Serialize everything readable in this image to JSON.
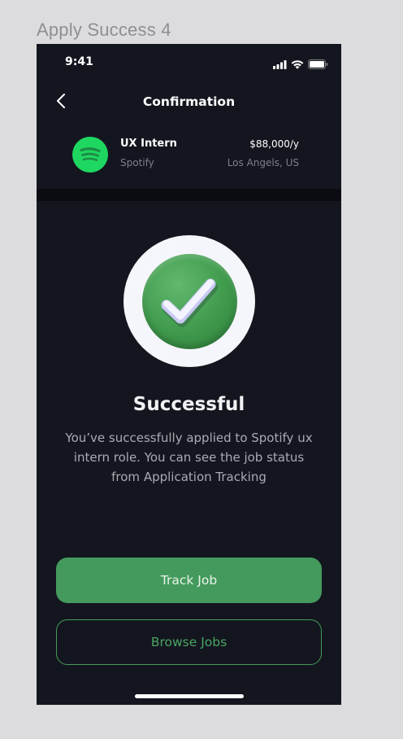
{
  "frame": {
    "title": "Apply Success 4"
  },
  "status_bar": {
    "time": "9:41",
    "icons": [
      "cellular-signal-icon",
      "wifi-icon",
      "battery-icon"
    ]
  },
  "header": {
    "back_icon": "chevron-left-icon",
    "title": "Confirmation"
  },
  "job": {
    "title": "UX Intern",
    "company": "Spotify",
    "salary": "$88,000/y",
    "location": "Los Angels, US",
    "logo_icon": "spotify-logo-icon"
  },
  "result": {
    "icon": "check-badge-icon",
    "title": "Successful",
    "message": "You’ve successfully applied to Spotify ux intern role. You can see the job status from Application Tracking"
  },
  "actions": {
    "primary_label": "Track Job",
    "secondary_label": "Browse Jobs"
  },
  "colors": {
    "background": "#14161f",
    "accent": "#449a5c",
    "spotify_green": "#1ed760",
    "canvas": "#dcdcde"
  }
}
